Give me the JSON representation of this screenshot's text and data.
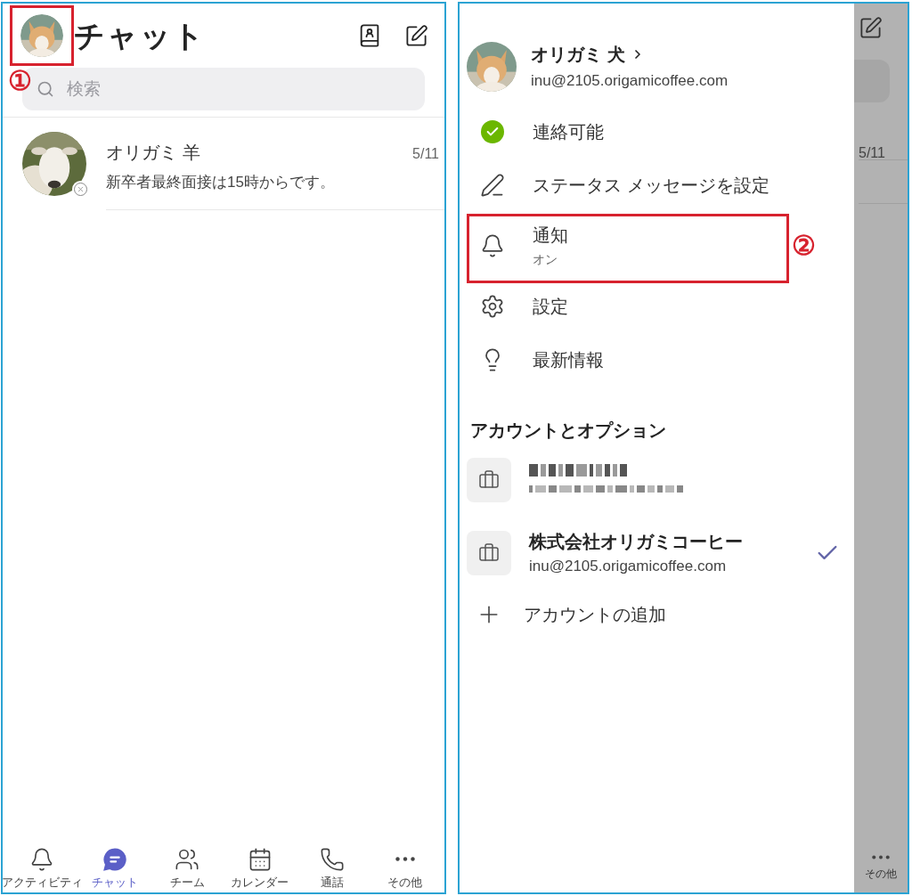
{
  "chat_screen": {
    "title": "チャット",
    "search": {
      "placeholder": "検索"
    },
    "chats": [
      {
        "name": "オリガミ 羊",
        "date": "5/11",
        "message": "新卒者最終面接は15時からです。",
        "offline": true
      }
    ],
    "nav": [
      {
        "kind": "activity",
        "label": "アクティビティ",
        "selected": false
      },
      {
        "kind": "chat",
        "label": "チャット",
        "selected": true
      },
      {
        "kind": "teams",
        "label": "チーム",
        "selected": false
      },
      {
        "kind": "calendar",
        "label": "カレンダー",
        "selected": false
      },
      {
        "kind": "calls",
        "label": "通話",
        "selected": false
      },
      {
        "kind": "more",
        "label": "その他",
        "selected": false
      }
    ]
  },
  "drawer": {
    "profile": {
      "name": "オリガミ 犬",
      "email": "inu@2105.origamicoffee.com"
    },
    "menu": [
      {
        "kind": "status",
        "label": "連絡可能",
        "color": "#6bb700"
      },
      {
        "kind": "status_message",
        "label": "ステータス メッセージを設定"
      },
      {
        "kind": "notifications",
        "label": "通知",
        "sublabel": "オン"
      },
      {
        "kind": "settings",
        "label": "設定"
      },
      {
        "kind": "whats_new",
        "label": "最新情報"
      }
    ],
    "section_title": "アカウントとオプション",
    "accounts": [
      {
        "kind": "redacted",
        "selected": false
      },
      {
        "kind": "account",
        "name": "株式会社オリガミコーヒー",
        "email": "inu@2105.origamicoffee.com",
        "selected": true
      }
    ],
    "add_account": "アカウントの追加",
    "behind": {
      "date": "5/11",
      "nav_label": "その他"
    }
  },
  "annotations": [
    {
      "label": "①"
    },
    {
      "label": "②"
    }
  ]
}
